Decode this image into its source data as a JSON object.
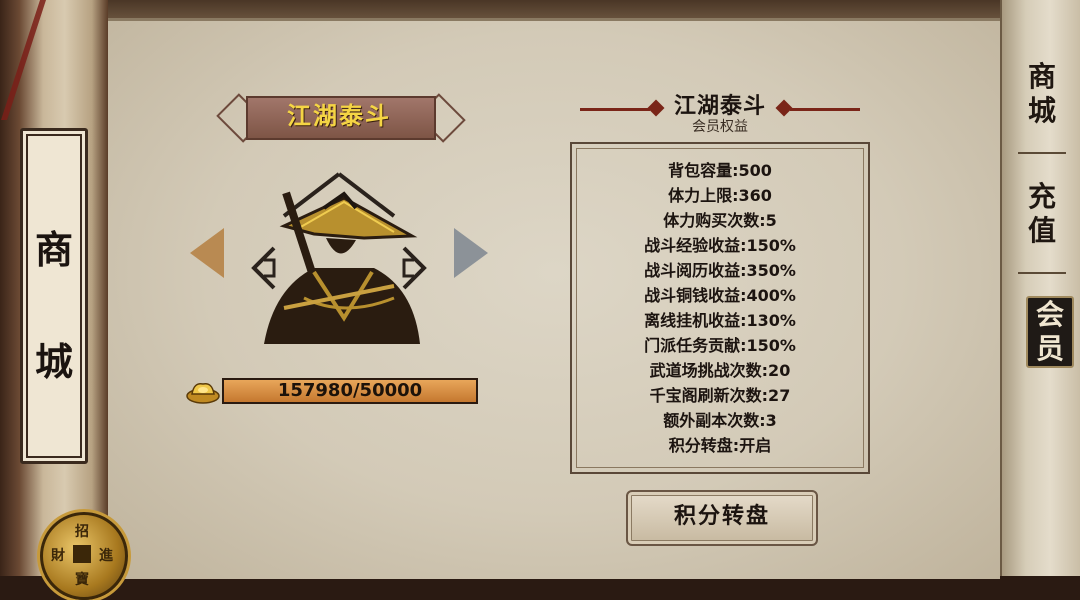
{
  "left_scroll": {
    "chars": [
      "商",
      "城"
    ]
  },
  "coin": {
    "chars": [
      "招",
      "財",
      "進",
      "寶"
    ]
  },
  "title_ribbon": {
    "text": "江湖泰斗"
  },
  "progress": {
    "text": "157980/50000",
    "value": 157980,
    "max": 50000,
    "fill_fraction": 1.0
  },
  "panel": {
    "title": "江湖泰斗",
    "subtitle": "会员权益",
    "items": [
      "背包容量:500",
      "体力上限:360",
      "体力购买次数:5",
      "战斗经验收益:150%",
      "战斗阅历收益:350%",
      "战斗铜钱收益:400%",
      "离线挂机收益:130%",
      "门派任务贡献:150%",
      "武道场挑战次数:20",
      "千宝阁刷新次数:27",
      "额外副本次数:3",
      "积分转盘:开启"
    ]
  },
  "button": {
    "label": "积分转盘"
  },
  "tabs": {
    "shop": [
      "商",
      "城"
    ],
    "recharge": [
      "充",
      "值"
    ],
    "member": [
      "会",
      "员"
    ]
  },
  "colors": {
    "ribbon_text": "#f5d544",
    "progress_fill": "#d98a3e",
    "accent_red": "#7a2518"
  },
  "icons": {
    "prev": "triangle-left-icon",
    "next": "triangle-right-icon",
    "currency": "gold-ingot-icon"
  }
}
